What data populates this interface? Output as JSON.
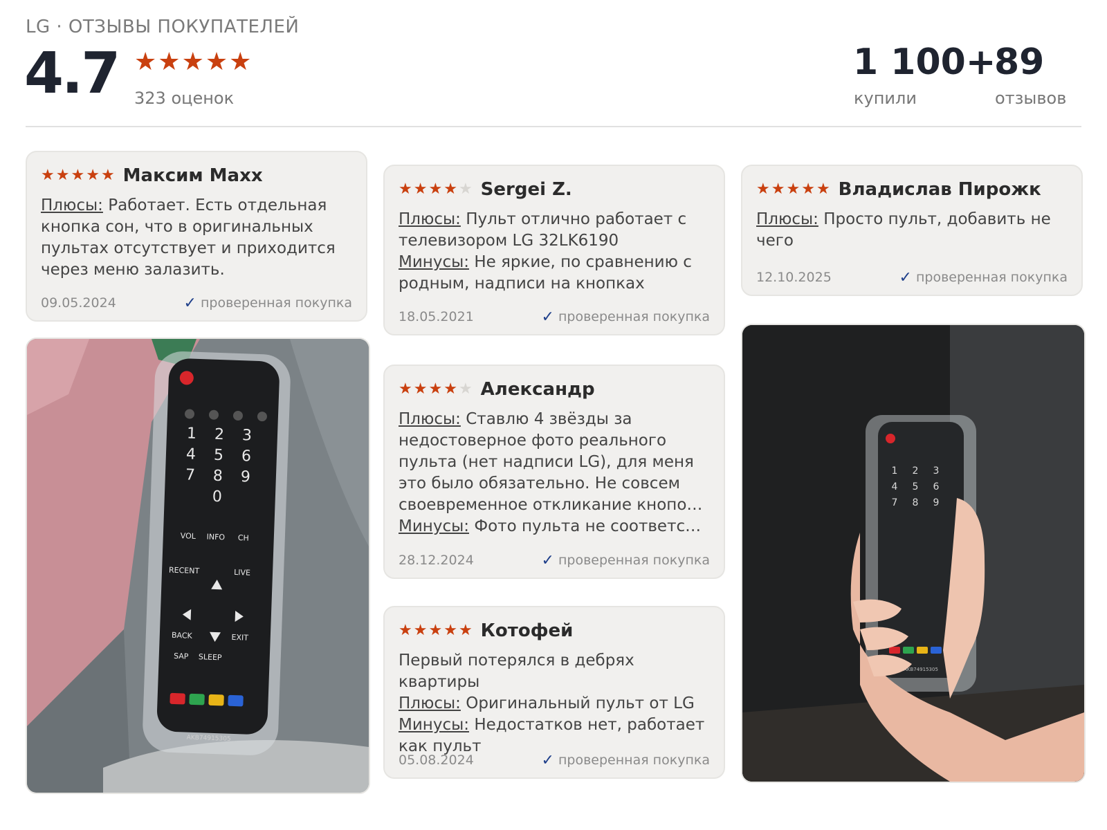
{
  "header": {
    "kicker": "LG · ОТЗЫВЫ ПОКУПАТЕЛЕЙ",
    "rating": "4.7",
    "rating_count": "323 оценок",
    "stars_filled": 5,
    "bought_value": "1 100+",
    "bought_label": "купили",
    "reviews_value": "89",
    "reviews_label": "отзывов"
  },
  "verified_label": "проверенная покупка",
  "reviews": [
    {
      "author": "Максим Maxx",
      "rating": 5,
      "lines": [
        {
          "label": "Плюсы:",
          "text": "Работает. Есть отдельная кнопка сон, что в оригинальных пультах отсутствует и приходится через меню залазить."
        }
      ],
      "date": "09.05.2024"
    },
    {
      "author": "Sergei Z.",
      "rating": 4,
      "lines": [
        {
          "label": "Плюсы:",
          "text": "Пульт отлично работает с телевизором LG 32LK6190"
        },
        {
          "label": "Минусы:",
          "text": "Не яркие, по сравнению с родным, надписи на кнопках"
        }
      ],
      "date": "18.05.2021"
    },
    {
      "author": "Владислав Пирожк",
      "rating": 5,
      "lines": [
        {
          "label": "Плюсы:",
          "text": "Просто пульт, добавить не чего"
        }
      ],
      "date": "12.10.2025"
    },
    {
      "author": "Александр",
      "rating": 4,
      "lines": [
        {
          "label": "Плюсы:",
          "text": "Ставлю 4 звёзды за недостоверное фото реального пульта (нет надписи LG), для меня это было обязательно. Не совсем"
        },
        {
          "label": "",
          "text": "своевременное откликание кнопок н…"
        },
        {
          "label": "Минусы:",
          "text": "Фото пульта не соответству…"
        }
      ],
      "date": "28.12.2024"
    },
    {
      "author": "Котофей",
      "rating": 5,
      "lines": [
        {
          "label": "",
          "text": "Первый потерялся в дебрях квартиры"
        },
        {
          "label": "Плюсы:",
          "text": "Оригинальный пульт от LG"
        },
        {
          "label": "Минусы:",
          "text": "Недостатков нет, работает как пульт"
        }
      ],
      "date": "05.08.2024"
    }
  ],
  "photos": [
    {
      "remote_model": "AKB74915305"
    },
    {
      "remote_model": "AKB74915305"
    }
  ],
  "colors": {
    "star": "#c9400f",
    "star_off": "#d8d6d2",
    "check": "#1f3f8a"
  }
}
